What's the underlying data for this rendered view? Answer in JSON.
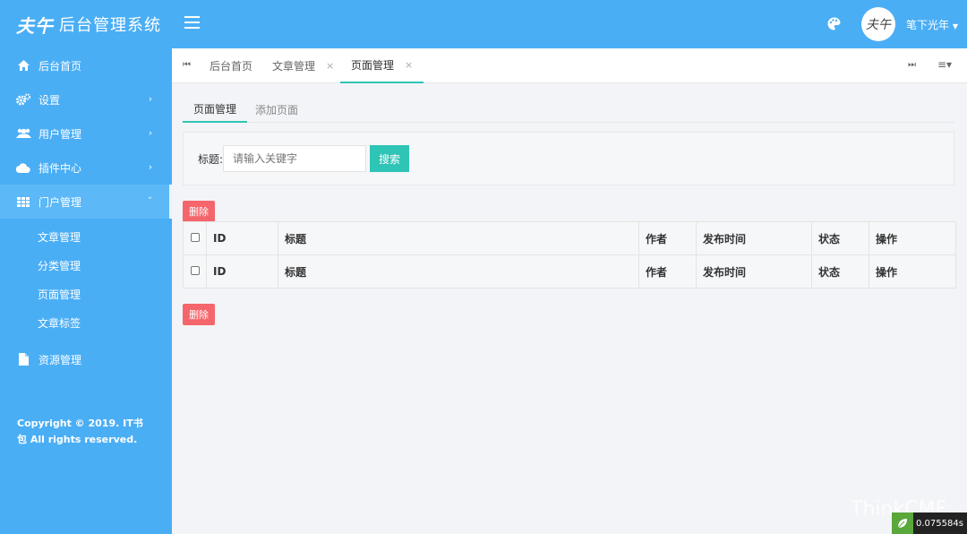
{
  "brand": {
    "logo_text": "夫午",
    "title": "后台管理系统"
  },
  "sidebar": {
    "items": [
      {
        "label": "后台首页",
        "icon": "home-icon"
      },
      {
        "label": "设置",
        "icon": "gear-icon"
      },
      {
        "label": "用户管理",
        "icon": "users-icon"
      },
      {
        "label": "插件中心",
        "icon": "cloud-icon"
      },
      {
        "label": "门户管理",
        "icon": "grid-icon"
      },
      {
        "label": "资源管理",
        "icon": "file-icon"
      }
    ],
    "submenu": [
      "文章管理",
      "分类管理",
      "页面管理",
      "文章标签"
    ],
    "copyright": "Copyright © 2019. IT书包 All rights reserved."
  },
  "header": {
    "username": "笔下光年",
    "avatar_text": "夫午"
  },
  "tabs": {
    "items": [
      {
        "label": "后台首页"
      },
      {
        "label": "文章管理",
        "close": "×"
      },
      {
        "label": "页面管理",
        "close": "×"
      }
    ],
    "first_icon": "⏮",
    "last_icon": "⏭",
    "menu_icon": "≡▾"
  },
  "subtabs": [
    "页面管理",
    "添加页面"
  ],
  "search": {
    "label": "标题:",
    "placeholder": "请输入关键字",
    "button": "搜索"
  },
  "actions": {
    "delete": "删除"
  },
  "table": {
    "columns": [
      "ID",
      "标题",
      "作者",
      "发布时间",
      "状态",
      "操作"
    ],
    "footer": [
      "ID",
      "标题",
      "作者",
      "发布时间",
      "状态",
      "操作"
    ]
  },
  "footer": {
    "watermark": "ThinkCMF",
    "timer": "0.075584s"
  },
  "colors": {
    "primary": "#4aaef5",
    "accent": "#2ec4b6",
    "danger": "#f4666b"
  }
}
